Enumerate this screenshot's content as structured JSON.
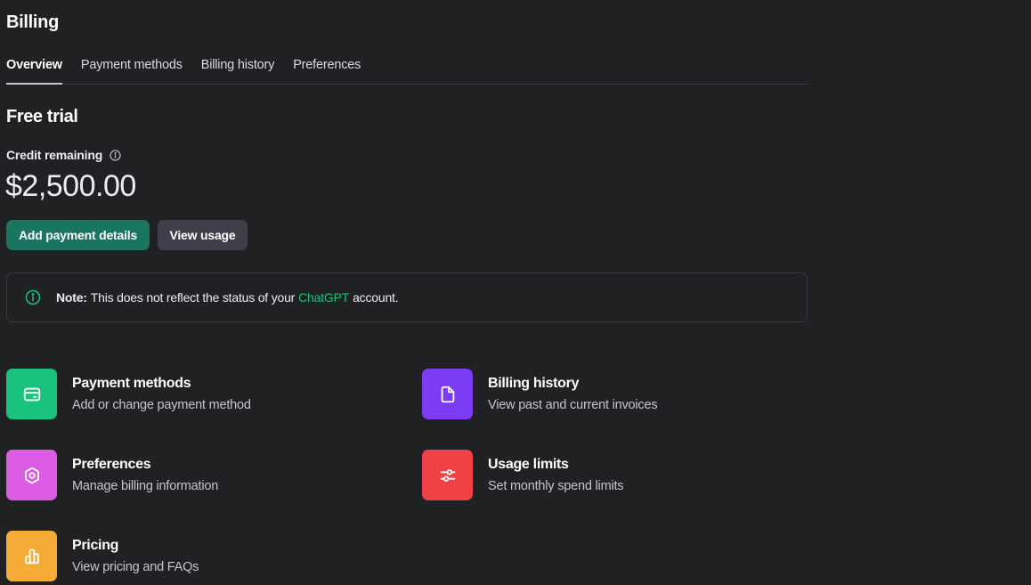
{
  "header": {
    "title": "Billing"
  },
  "tabs": [
    {
      "label": "Overview"
    },
    {
      "label": "Payment methods"
    },
    {
      "label": "Billing history"
    },
    {
      "label": "Preferences"
    }
  ],
  "plan": {
    "title": "Free trial",
    "credit_label": "Credit remaining",
    "credit_amount": "$2,500.00"
  },
  "actions": {
    "add_payment": "Add payment details",
    "view_usage": "View usage"
  },
  "note": {
    "prefix": "Note:",
    "text_before": "This does not reflect the status of your",
    "link": "ChatGPT",
    "text_after": "account."
  },
  "cards": [
    {
      "title": "Payment methods",
      "desc": "Add or change payment method",
      "icon": "credit-card-icon",
      "color": "#19c37d"
    },
    {
      "title": "Billing history",
      "desc": "View past and current invoices",
      "icon": "document-icon",
      "color": "#7e3cf2"
    },
    {
      "title": "Preferences",
      "desc": "Manage billing information",
      "icon": "settings-icon",
      "color": "#dd5ce5"
    },
    {
      "title": "Usage limits",
      "desc": "Set monthly spend limits",
      "icon": "sliders-icon",
      "color": "#ef4146"
    },
    {
      "title": "Pricing",
      "desc": "View pricing and FAQs",
      "icon": "bar-chart-icon",
      "color": "#f4ac36"
    }
  ],
  "colors": {
    "background": "#202123",
    "accent": "#197560",
    "link": "#19c37d"
  }
}
